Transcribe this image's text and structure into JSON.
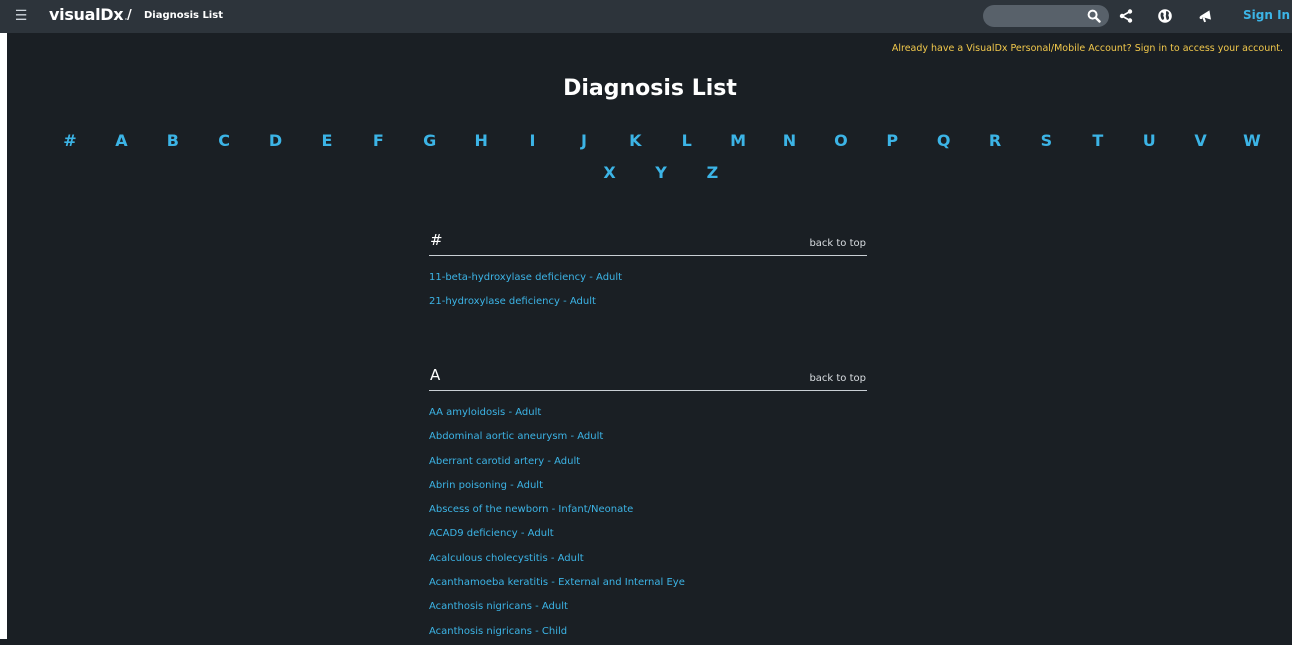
{
  "header": {
    "menu_icon": "hamburger-icon",
    "logo": "visualDx",
    "logo_dot": ".",
    "breadcrumb_separator": "/",
    "breadcrumb": "Diagnosis List",
    "search": {
      "value": "",
      "placeholder": ""
    },
    "icons": [
      "search-icon",
      "share-icon",
      "globe-icon",
      "megaphone-icon"
    ],
    "sign_in": "Sign In"
  },
  "notice": {
    "text": "Already have a VisualDx Personal/Mobile Account?",
    "link": "Sign in to access your account."
  },
  "page_title": "Diagnosis List",
  "alphabet": [
    "#",
    "A",
    "B",
    "C",
    "D",
    "E",
    "F",
    "G",
    "H",
    "I",
    "J",
    "K",
    "L",
    "M",
    "N",
    "O",
    "P",
    "Q",
    "R",
    "S",
    "T",
    "U",
    "V",
    "W",
    "X",
    "Y",
    "Z"
  ],
  "sections": [
    {
      "letter": "#",
      "back_to_top": "back to top",
      "items": [
        "11-beta-hydroxylase deficiency - Adult",
        "21-hydroxylase deficiency - Adult"
      ]
    },
    {
      "letter": "A",
      "back_to_top": "back to top",
      "items": [
        "AA amyloidosis - Adult",
        "Abdominal aortic aneurysm - Adult",
        "Aberrant carotid artery - Adult",
        "Abrin poisoning - Adult",
        "Abscess of the newborn - Infant/Neonate",
        "ACAD9 deficiency - Adult",
        "Acalculous cholecystitis - Adult",
        "Acanthamoeba keratitis - External and Internal Eye",
        "Acanthosis nigricans - Adult",
        "Acanthosis nigricans - Child"
      ]
    }
  ],
  "colors": {
    "background": "#1a1f24",
    "topbar": "#2d343b",
    "link": "#3cb4e6",
    "notice": "#f2c94c"
  }
}
